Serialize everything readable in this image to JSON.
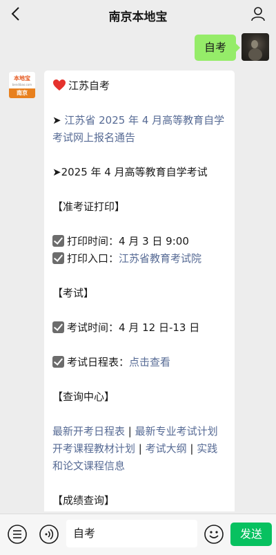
{
  "header": {
    "title": "南京本地宝"
  },
  "sent_message": {
    "text": "自考"
  },
  "bot": {
    "logo_top": "本地宝",
    "logo_mid": "bendibao.com",
    "logo_bottom": "南京"
  },
  "reply": {
    "heading": "江苏自考",
    "notice_prefix": "➤ ",
    "notice_link": "江苏省 2025 年 4 月高等教育自学考试网上报名通告",
    "exam_line": "➤2025 年 4 月高等教育自学考试",
    "section_admission": "【准考证打印】",
    "print_time_label": "打印时间：",
    "print_time_value": "4 月 3 日 9:00",
    "print_entry_label": "打印入口：",
    "print_entry_link": "江苏省教育考试院",
    "section_exam": "【考试】",
    "exam_time_label": "考试时间：",
    "exam_time_value": "4 月 12 日-13 日",
    "schedule_label": "考试日程表：",
    "schedule_link": "点击查看",
    "section_query": "【查询中心】",
    "query_links_1a": "最新开考日程表",
    "sep": " | ",
    "query_links_1b": "最新专业考试计划",
    "query_links_2a": "开考课程教材计划",
    "query_links_2b": "考试大纲",
    "query_links_2c": "实践和论文课程信息",
    "section_score": "【成绩查询】"
  },
  "input_bar": {
    "input_value": "自考",
    "send_label": "发送"
  },
  "colors": {
    "send": "#07c160",
    "bubble_mine": "#95ec69",
    "link": "#576b95",
    "heart": "#e5322d"
  },
  "icons": [
    "back-arrow-icon",
    "profile-icon",
    "menu-list-icon",
    "voice-icon",
    "emoji-icon",
    "heart-icon",
    "checkbox-icon"
  ]
}
